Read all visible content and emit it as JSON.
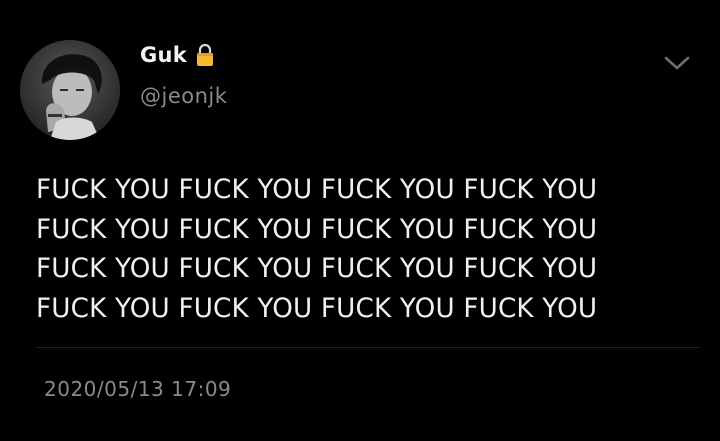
{
  "user": {
    "display_name": "Guk",
    "handle": "@jeonjk",
    "locked_icon": "lock-icon",
    "avatar_icon": "avatar"
  },
  "tweet": {
    "lines": [
      "FUCK YOU FUCK YOU FUCK YOU FUCK YOU",
      "FUCK YOU FUCK YOU FUCK YOU FUCK YOU",
      "FUCK YOU FUCK YOU FUCK YOU FUCK YOU",
      "FUCK YOU FUCK YOU FUCK YOU FUCK YOU"
    ],
    "timestamp": "2020/05/13 17:09"
  },
  "menu": {
    "icon": "chevron-down-icon"
  },
  "colors": {
    "background": "#000000",
    "primary_text": "#f0f0f0",
    "secondary_text": "#8a8a8a",
    "lock": "#f5b82e"
  }
}
